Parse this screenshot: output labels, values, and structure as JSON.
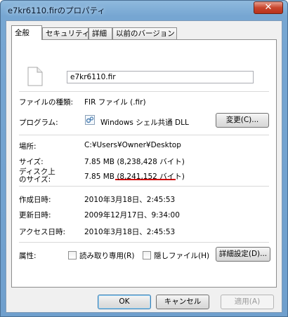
{
  "window": {
    "title": "e7kr6110.firのプロパティ",
    "close_label": "✕"
  },
  "tabs": [
    {
      "label": "全般",
      "active": true
    },
    {
      "label": "セキュリティ",
      "active": false
    },
    {
      "label": "詳細",
      "active": false
    },
    {
      "label": "以前のバージョン",
      "active": false
    }
  ],
  "general": {
    "filename": "e7kr6110.fir",
    "file_type_label": "ファイルの種類:",
    "file_type_value": "FIR ファイル (.fir)",
    "program_label": "プログラム:",
    "program_value": "Windows シェル共通 DLL",
    "change_button": "変更(C)...",
    "location_label": "場所:",
    "location_value": "C:¥Users¥Owner¥Desktop",
    "size_label": "サイズ:",
    "size_value": "7.85 MB (8,238,428 バイト)",
    "disk_size_label_line1": "ディスク上",
    "disk_size_label_line2": "のサイズ:",
    "disk_size_value": "7.85 MB (8,241,152 バイト)",
    "created_label": "作成日時:",
    "created_value": "2010年3月18日、2:45:53",
    "modified_label": "更新日時:",
    "modified_value": "2009年12月17日、9:34:00",
    "accessed_label": "アクセス日時:",
    "accessed_value": "2010年3月18日、2:45:53",
    "attributes_label": "属性:",
    "readonly_label": "読み取り専用(R)",
    "hidden_label": "隠しファイル(H)",
    "advanced_button": "詳細設定(D)...",
    "readonly_checked": false,
    "hidden_checked": false
  },
  "footer": {
    "ok": "OK",
    "cancel": "キャンセル",
    "apply": "適用(A)"
  },
  "colors": {
    "highlight_underline": "#d20000"
  }
}
